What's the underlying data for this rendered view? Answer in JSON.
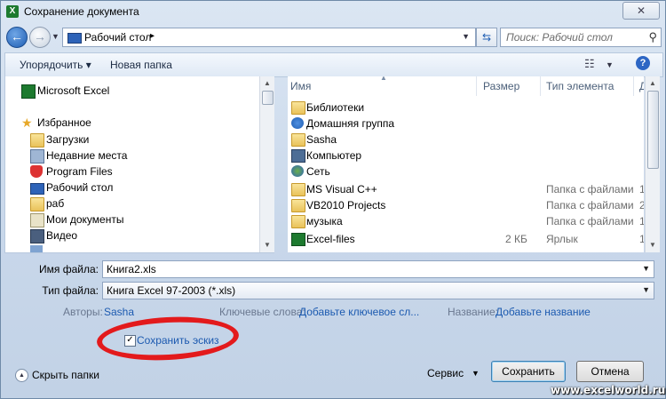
{
  "window": {
    "title": "Сохранение документа",
    "close_symbol": "✕"
  },
  "address": {
    "location": "Рабочий стол",
    "arrow": "▸",
    "search_placeholder": "Поиск: Рабочий стол"
  },
  "toolbar": {
    "organize": "Упорядочить",
    "new_folder": "Новая папка"
  },
  "nav_pane": {
    "items": [
      {
        "label": "Microsoft Excel",
        "icon": "excel-icon"
      },
      {
        "label": "Избранное",
        "icon": "star-icon"
      },
      {
        "label": "Загрузки",
        "icon": "downloads-icon"
      },
      {
        "label": "Недавние места",
        "icon": "recent-places-icon"
      },
      {
        "label": "Program Files",
        "icon": "shield-icon"
      },
      {
        "label": "Рабочий стол",
        "icon": "desktop-icon"
      },
      {
        "label": "раб",
        "icon": "shortcut-icon"
      },
      {
        "label": "Мои документы",
        "icon": "documents-icon"
      },
      {
        "label": "Видео",
        "icon": "video-icon"
      }
    ]
  },
  "file_list": {
    "columns": {
      "name": "Имя",
      "size": "Размер",
      "type": "Тип элемента",
      "date": "Д"
    },
    "rows": [
      {
        "name": "Библиотеки",
        "size": "",
        "type": "",
        "date": "",
        "icon": "libraries-icon"
      },
      {
        "name": "Домашняя группа",
        "size": "",
        "type": "",
        "date": "",
        "icon": "homegroup-icon"
      },
      {
        "name": "Sasha",
        "size": "",
        "type": "",
        "date": "",
        "icon": "user-folder-icon"
      },
      {
        "name": "Компьютер",
        "size": "",
        "type": "",
        "date": "",
        "icon": "computer-icon"
      },
      {
        "name": "Сеть",
        "size": "",
        "type": "",
        "date": "",
        "icon": "network-icon"
      },
      {
        "name": "MS Visual C++",
        "size": "",
        "type": "Папка с файлами",
        "date": "1",
        "icon": "folder-icon"
      },
      {
        "name": "VB2010 Projects",
        "size": "",
        "type": "Папка с файлами",
        "date": "2",
        "icon": "folder-icon"
      },
      {
        "name": "музыка",
        "size": "",
        "type": "Папка с файлами",
        "date": "1",
        "icon": "folder-icon"
      },
      {
        "name": "Excel-files",
        "size": "2 КБ",
        "type": "Ярлык",
        "date": "1",
        "icon": "shortcut-icon"
      }
    ]
  },
  "form": {
    "filename_label": "Имя файла:",
    "filename_value": "Книга2.xls",
    "filetype_label": "Тип файла:",
    "filetype_value": "Книга Excel 97-2003 (*.xls)",
    "authors_label": "Авторы:",
    "authors_value": "Sasha",
    "keywords_label": "Ключевые слова:",
    "keywords_value": "Добавьте ключевое сл...",
    "title_label": "Название:",
    "title_value": "Добавьте название",
    "thumbnail_label": "Сохранить эскиз",
    "thumbnail_checked": "✓"
  },
  "footer": {
    "hide_folders": "Скрыть папки",
    "service": "Сервис",
    "save": "Сохранить",
    "cancel": "Отмена"
  },
  "watermark": "www.excelworld.ru",
  "colors": {
    "annotation": "#e31a1c",
    "link": "#1c5ab0"
  }
}
